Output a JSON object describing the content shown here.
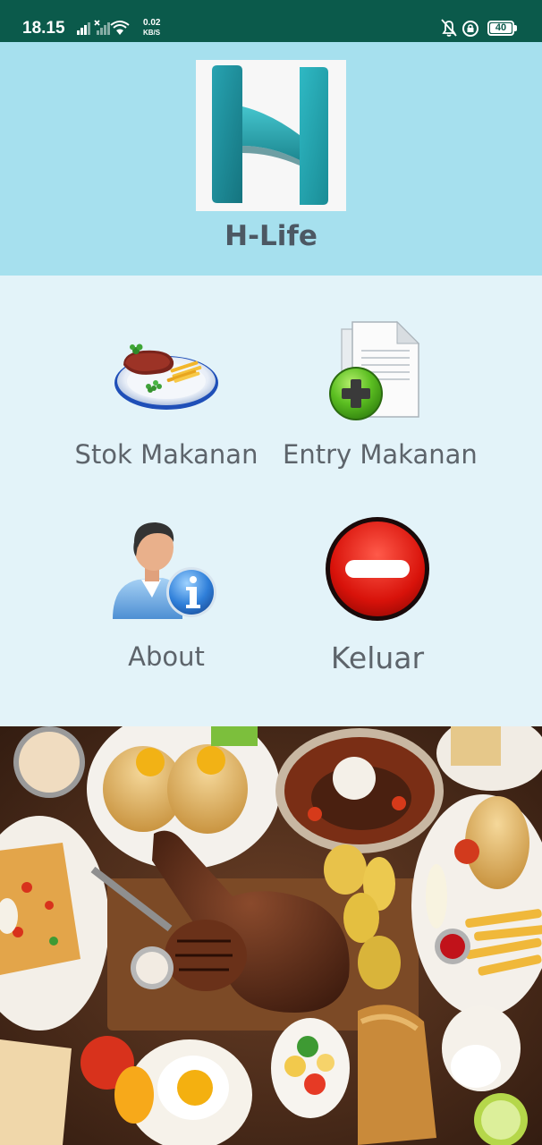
{
  "status_bar": {
    "time": "18.15",
    "net_speed_value": "0.02",
    "net_speed_unit": "KB/S",
    "battery_level": "40"
  },
  "header": {
    "app_title": "H-Life",
    "logo_icon": "h-life-logo",
    "background_color": "#a6e0ee"
  },
  "menu": {
    "items": [
      {
        "label": "Stok Makanan",
        "icon": "food-plate-icon"
      },
      {
        "label": "Entry Makanan",
        "icon": "add-document-icon"
      },
      {
        "label": "About",
        "icon": "user-info-icon"
      },
      {
        "label": "Keluar",
        "icon": "exit-minus-icon"
      }
    ],
    "background_color": "#e3f3f9"
  },
  "banner": {
    "image": "food-platter-photo"
  }
}
